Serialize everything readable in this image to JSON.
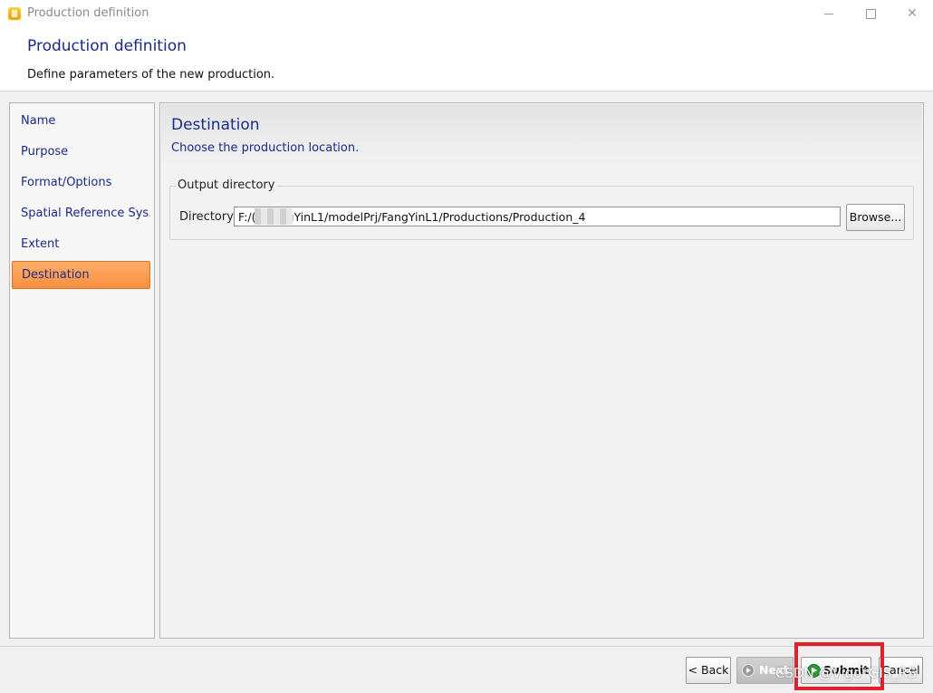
{
  "window": {
    "title": "Production definition",
    "controls": {
      "minimize": "minimize",
      "maximize": "maximize",
      "close": "✕"
    }
  },
  "header": {
    "title": "Production definition",
    "subtitle": "Define parameters of the new production."
  },
  "nav": {
    "items": [
      {
        "label": "Name"
      },
      {
        "label": "Purpose"
      },
      {
        "label": "Format/Options"
      },
      {
        "label": "Spatial Reference Sys..."
      },
      {
        "label": "Extent"
      },
      {
        "label": "Destination"
      }
    ],
    "active": "Destination"
  },
  "content": {
    "title": "Destination",
    "subtitle": "Choose the production location.",
    "group_title": "Output directory",
    "directory_label": "Directory",
    "directory_value": "F:/( :/FangYinL1/modelPrj/FangYinL1/Productions/Production_4",
    "browse_label": "Browse..."
  },
  "footer": {
    "back_label": "< Back",
    "next_label": "Next",
    "submit_label": "Submit",
    "cancel_label": "Cancel"
  },
  "watermark": "CSDN @Vigo*GIS_RS",
  "colors": {
    "accent_text": "#1a2a8a",
    "active_item": "#f98f3f",
    "highlight": "#e0202a",
    "submit_icon": "#2a9a36"
  },
  "icons": {
    "app": "app-icon",
    "next": "arrow-right-circle-icon",
    "submit": "arrow-right-circle-icon"
  }
}
